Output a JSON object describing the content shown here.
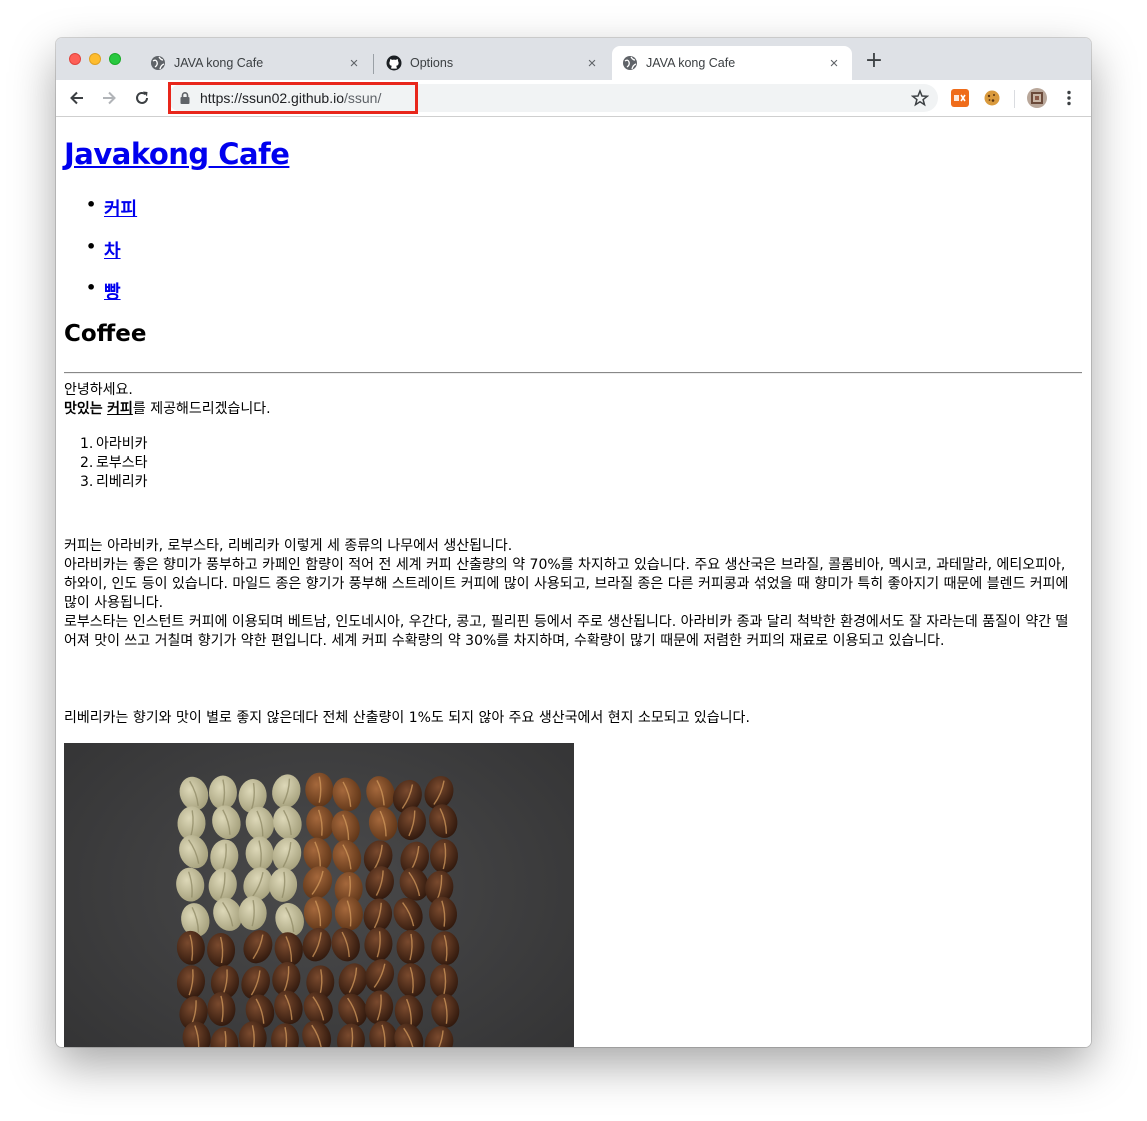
{
  "browser": {
    "tabs": [
      {
        "title": "JAVA kong Cafe",
        "favicon": "globe-icon",
        "active": false
      },
      {
        "title": "Options",
        "favicon": "github-icon",
        "active": false
      },
      {
        "title": "JAVA kong Cafe",
        "favicon": "globe-icon",
        "active": true
      }
    ],
    "close_glyph": "×",
    "new_tab_glyph": "+",
    "url_host": "https://ssun02.github.io",
    "url_path": "/ssun/",
    "highlight_color": "#e8261b"
  },
  "page": {
    "site_title": "Javakong Cafe",
    "nav": [
      {
        "label": "커피"
      },
      {
        "label": "차"
      },
      {
        "label": "빵"
      }
    ],
    "section_title": "Coffee",
    "greeting": "안녕하세요.",
    "offer_bold": "맛있는",
    "offer_link": "커피",
    "offer_rest": "를 제공해드리겠습니다.",
    "beans": [
      {
        "num": "1.",
        "name": "아라비카"
      },
      {
        "num": "2.",
        "name": "로부스타"
      },
      {
        "num": "3.",
        "name": "리베리카"
      }
    ],
    "paragraph1": [
      "커피는 아라비카, 로부스타, 리베리카 이렇게 세 종류의 나무에서 생산됩니다.",
      "아라비카는 좋은 향미가 풍부하고 카페인 함량이 적어 전 세계 커피 산출량의 약 70%를 차지하고 있습니다. 주요 생산국은 브라질, 콜롬비아, 멕시코, 과테말라, 에티오피아, 하와이, 인도 등이 있습니다. 마일드 종은 향기가 풍부해 스트레이트 커피에 많이 사용되고, 브라질 종은 다른 커피콩과 섞었을 때 향미가 특히 좋아지기 때문에 블렌드 커피에 많이 사용됩니다.",
      "로부스타는 인스턴트 커피에 이용되며 베트남, 인도네시아, 우간다, 콩고, 필리핀 등에서 주로 생산됩니다. 아라비카 종과 달리 척박한 환경에서도 잘 자라는데 품질이 약간 떨어져 맛이 쓰고 거칠며 향기가 약한 편입니다. 세계 커피 수확량의 약 30%를 차지하며, 수확량이 많기 때문에 저렴한 커피의 재료로 이용되고 있습니다."
    ],
    "paragraph2": "리베리카는 향기와 맛이 별로 좋지 않은데다 전체 산출량이 1%도 되지 않아 주요 생산국에서 현지 소모되고 있습니다."
  }
}
